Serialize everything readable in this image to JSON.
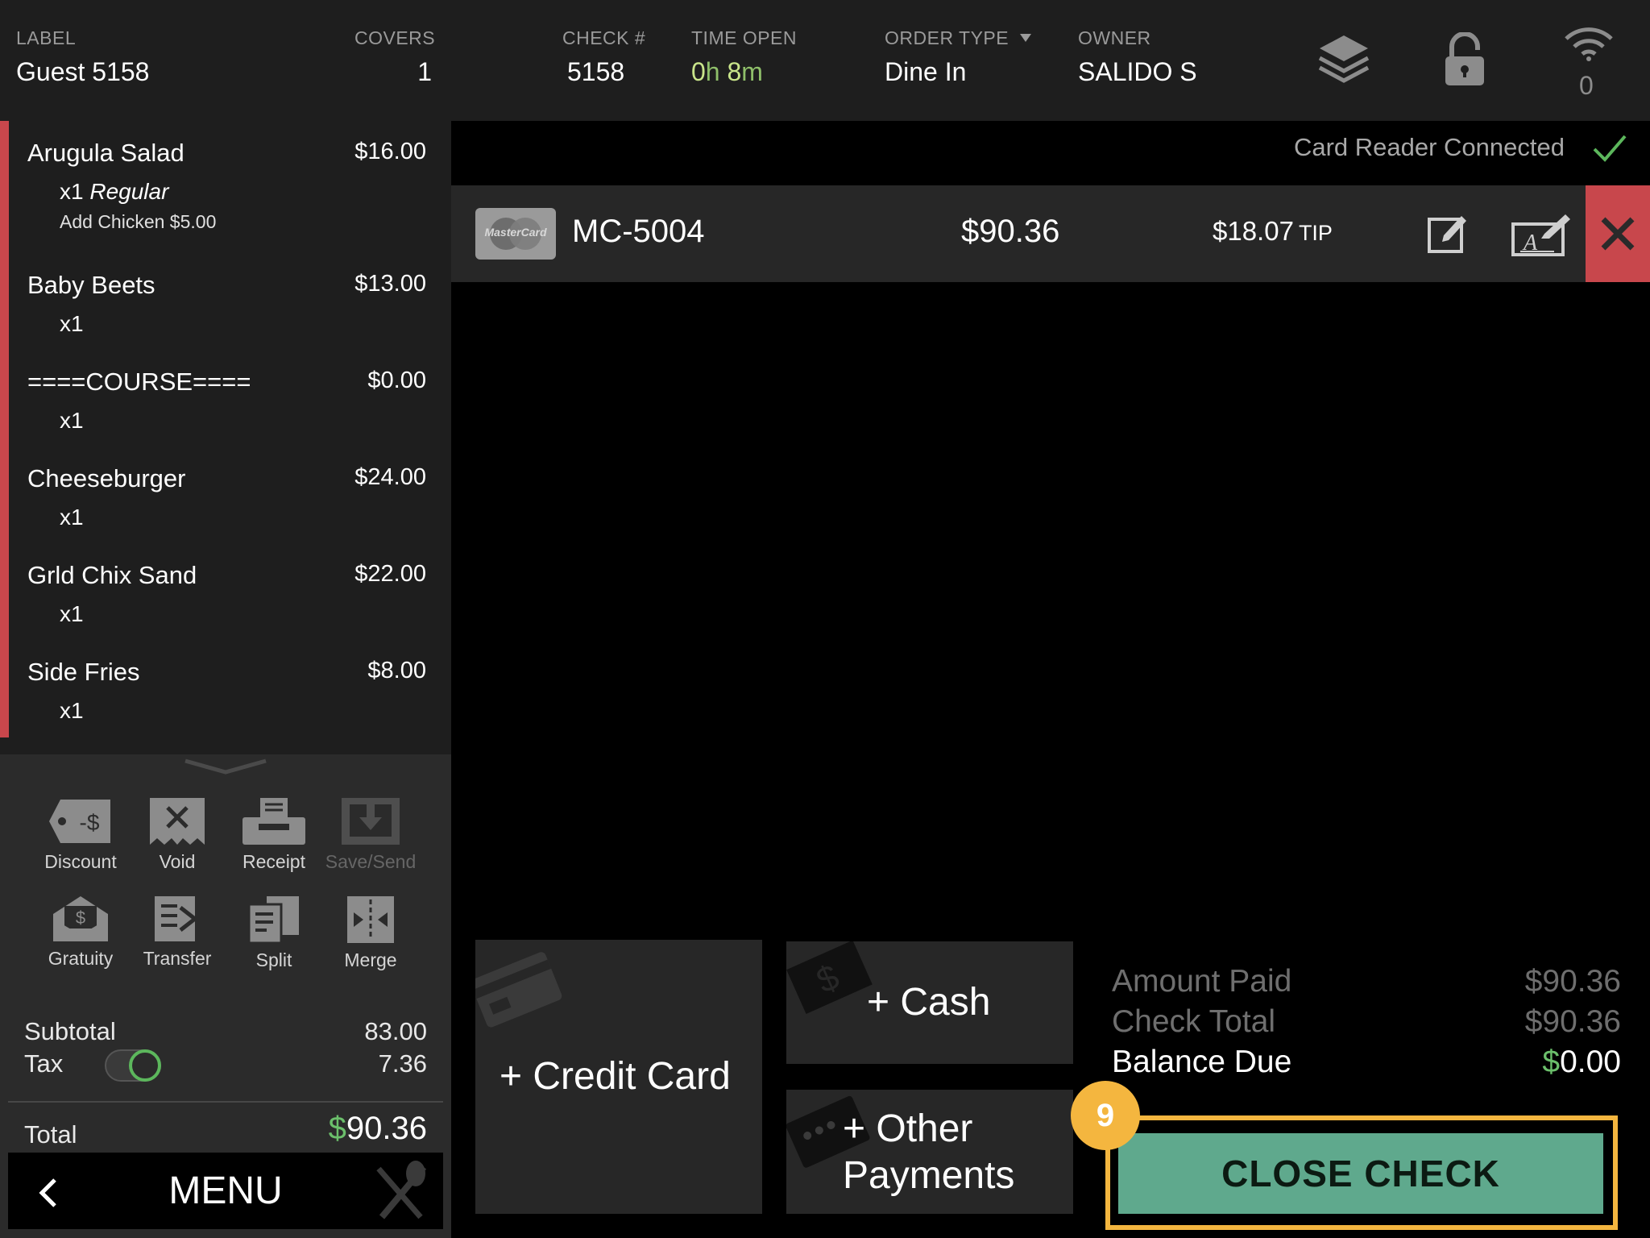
{
  "header": {
    "label": {
      "caption": "LABEL",
      "value": "Guest 5158"
    },
    "covers": {
      "caption": "COVERS",
      "value": "1"
    },
    "check": {
      "caption": "CHECK #",
      "value": "5158"
    },
    "time_open": {
      "caption": "TIME OPEN",
      "hours": "0",
      "h_unit": "h",
      "minutes": "8",
      "m_unit": "m"
    },
    "order_type": {
      "caption": "ORDER TYPE",
      "value": "Dine In"
    },
    "owner": {
      "caption": "OWNER",
      "value": "SALIDO S"
    },
    "icons": [
      "layers-icon",
      "lock-icon",
      "wifi-icon"
    ],
    "wifi_count": "0"
  },
  "order_items": [
    {
      "name": "Arugula Salad",
      "price": "$16.00",
      "qty": "x1",
      "variant": "Regular",
      "modifier": "Add Chicken $5.00"
    },
    {
      "name": "Baby Beets",
      "price": "$13.00",
      "qty": "x1"
    },
    {
      "name": "====COURSE====",
      "price": "$0.00",
      "qty": "x1"
    },
    {
      "name": "Cheeseburger",
      "price": "$24.00",
      "qty": "x1"
    },
    {
      "name": "Grld Chix Sand",
      "price": "$22.00",
      "qty": "x1"
    },
    {
      "name": "Side Fries",
      "price": "$8.00",
      "qty": "x1"
    }
  ],
  "actions": [
    {
      "label": "Discount",
      "icon": "discount-tag-icon",
      "enabled": true
    },
    {
      "label": "Void",
      "icon": "void-receipt-icon",
      "enabled": true
    },
    {
      "label": "Receipt",
      "icon": "printer-icon",
      "enabled": true
    },
    {
      "label": "Save/Send",
      "icon": "save-send-icon",
      "enabled": false
    },
    {
      "label": "Gratuity",
      "icon": "gratuity-envelope-icon",
      "enabled": true
    },
    {
      "label": "Transfer",
      "icon": "transfer-icon",
      "enabled": true
    },
    {
      "label": "Split",
      "icon": "split-icon",
      "enabled": true
    },
    {
      "label": "Merge",
      "icon": "merge-icon",
      "enabled": true
    }
  ],
  "summary": {
    "subtotal_label": "Subtotal",
    "subtotal": "83.00",
    "tax_label": "Tax",
    "tax": "7.36",
    "tax_enabled": true,
    "total_label": "Total",
    "total_symbol": "$",
    "total": "90.36"
  },
  "menu_button": {
    "label": "MENU"
  },
  "card_reader": {
    "status": "Card Reader Connected"
  },
  "payments": [
    {
      "brand": "MasterCard",
      "card": "MC-5004",
      "amount": "$90.36",
      "tip": "$18.07",
      "tip_label": "TIP"
    }
  ],
  "tenders": {
    "credit_card": "+ Credit Card",
    "cash": "+ Cash",
    "other_line1": "+ Other",
    "other_line2": "Payments"
  },
  "balance": {
    "amount_paid_label": "Amount Paid",
    "amount_paid": "$90.36",
    "check_total_label": "Check Total",
    "check_total": "$90.36",
    "balance_due_label": "Balance Due",
    "balance_symbol": "$",
    "balance_due": "0.00"
  },
  "close_check": {
    "label": "CLOSE CHECK"
  },
  "step_badge": "9",
  "colors": {
    "accent_red": "#c8474c",
    "accent_green": "#5fa98d",
    "highlight": "#f4b63f",
    "time_green": "#c9e58a"
  }
}
